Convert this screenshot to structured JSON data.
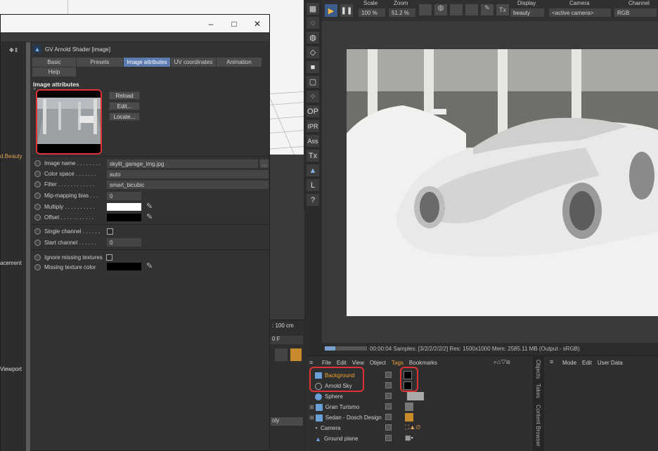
{
  "dialog": {
    "title_buttons": {
      "minimize": "–",
      "maximize": "□",
      "close": "✕"
    },
    "header_title": "GV Arnold Shader [image]",
    "tabs": [
      {
        "label": "Basic"
      },
      {
        "label": "Presets"
      },
      {
        "label": "Image attributes",
        "active": true
      },
      {
        "label": "UV coordinates"
      },
      {
        "label": "Animation"
      },
      {
        "label": "Help"
      }
    ],
    "section_title": "Image attributes",
    "buttons": {
      "reload": "Reload",
      "edit": "Edit...",
      "locate": "Locate..."
    },
    "rows": {
      "image_name": {
        "label": "Image name . . . . . . . .",
        "value": "skylit_garage_img.jpg"
      },
      "color_space": {
        "label": "Color space . . . . . . .",
        "value": "auto"
      },
      "filter": {
        "label": "Filter . . . . . . . . . . . .",
        "value": "smart_bicubic"
      },
      "mip_bias": {
        "label": "Mip-mapping bias . . .",
        "value": "0"
      },
      "multiply": {
        "label": "Multiply . . . . . . . . . ."
      },
      "offset": {
        "label": "Offset . . . . . . . . . . ."
      },
      "single_channel": {
        "label": "Single channel . . . . . ."
      },
      "start_channel": {
        "label": "Start channel . . . . . .",
        "value": "0"
      },
      "ignore_missing": {
        "label": "Ignore missing textures"
      },
      "missing_color": {
        "label": "Missing texture color"
      }
    }
  },
  "left_labels": {
    "beauty": "d.Beauty",
    "placement": "acement",
    "viewport": "Viewport"
  },
  "mid": {
    "unit": ": 100 cm",
    "frame": "0 F",
    "ply": "oly"
  },
  "render": {
    "toolbar": {
      "scale_label": "Scale",
      "scale_value": "100 %",
      "zoom_label": "Zoom",
      "zoom_value": "51.2 %",
      "display_label": "Display",
      "display_value": "beauty",
      "camera_label": "Camera",
      "camera_value": "<active camera>",
      "channel_label": "Channel",
      "channel_value": "RGB",
      "tx": "Tx"
    },
    "side_buttons": [
      "OP",
      "IPR",
      "Ass",
      "Tx",
      "L",
      "?"
    ],
    "status": "00:00:04  Samples: [3/2/2/2/2/2]  Res: 1500x1000  Mem: 2585.11 MB  (Output - sRGB)"
  },
  "objects": {
    "menu": [
      "File",
      "Edit",
      "View",
      "Object",
      "Tags",
      "Bookmarks"
    ],
    "active_menu": "Tags",
    "items": [
      {
        "name": "Background",
        "highlight": true
      },
      {
        "name": "Arnold Sky",
        "highlight": false
      },
      {
        "name": "Sphere",
        "highlight": false
      },
      {
        "name": "Gran Turismo",
        "highlight": false
      },
      {
        "name": "Sedan - Dosch Design",
        "highlight": false
      },
      {
        "name": "Camera",
        "highlight": false
      },
      {
        "name": "Ground plane",
        "highlight": false
      }
    ],
    "side_tabs": [
      "Objects",
      "Takes",
      "Content Browser"
    ]
  },
  "attributes": {
    "menu": [
      "Mode",
      "Edit",
      "User Data"
    ]
  },
  "colors": {
    "accent": "#5c7bb0",
    "highlight_red": "#dd3333",
    "tag_orange": "#f0a030"
  }
}
